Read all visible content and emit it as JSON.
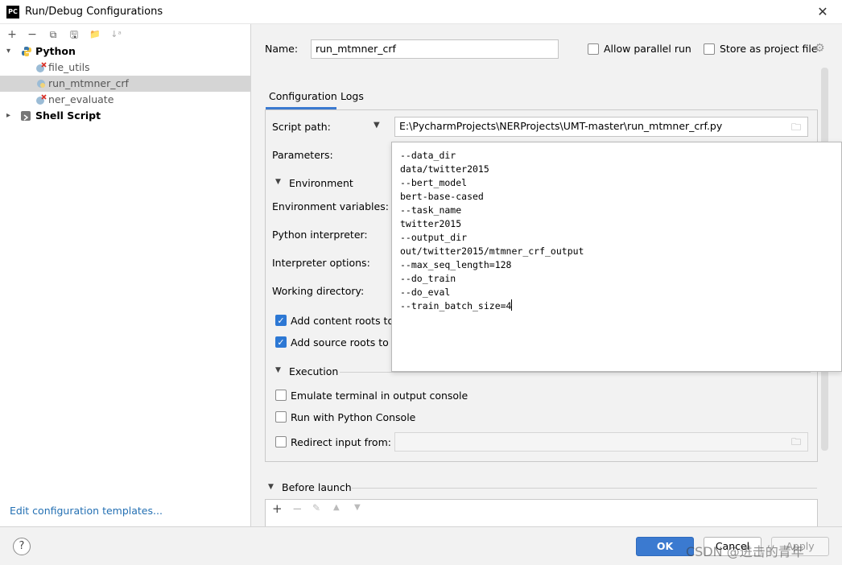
{
  "window": {
    "title": "Run/Debug Configurations",
    "logo_text": "PC",
    "close_glyph": "✕"
  },
  "left_toolbar": {
    "add": "+",
    "remove": "−",
    "copy": "⧉",
    "save": "🖫",
    "folder": "📁",
    "sort": "↓ᵃ"
  },
  "tree": {
    "python_label": "Python",
    "python_children": [
      {
        "label": "file_utils",
        "state": "error"
      },
      {
        "label": "run_mtmner_crf",
        "state": "selected"
      },
      {
        "label": "ner_evaluate",
        "state": "error"
      }
    ],
    "shell_label": "Shell Script"
  },
  "edit_templates_link": "Edit configuration templates...",
  "form": {
    "name_label": "Name:",
    "name_value": "run_mtmner_crf",
    "allow_parallel": "Allow parallel run",
    "store_project": "Store as project file",
    "tabs": [
      "Configuration",
      "Logs"
    ],
    "script_path_label": "Script path:",
    "script_path_value": "E:\\PycharmProjects\\NERProjects\\UMT-master\\run_mtmner_crf.py",
    "parameters_label": "Parameters:",
    "environment_section": "Environment",
    "env_vars_label": "Environment variables:",
    "interpreter_label": "Python interpreter:",
    "interp_options_label": "Interpreter options:",
    "working_dir_label": "Working directory:",
    "add_content_roots": "Add content roots to",
    "add_source_roots": "Add source roots to P",
    "execution_section": "Execution",
    "emulate_terminal": "Emulate terminal in output console",
    "run_python_console": "Run with Python Console",
    "redirect_input": "Redirect input from:",
    "before_launch": "Before launch"
  },
  "parameters_text": "--data_dir\ndata/twitter2015\n--bert_model\nbert-base-cased\n--task_name\ntwitter2015\n--output_dir\nout/twitter2015/mtmner_crf_output\n--max_seq_length=128\n--do_train\n--do_eval\n--train_batch_size=4",
  "buttons": {
    "help": "?",
    "ok": "OK",
    "cancel": "Cancel",
    "apply": "Apply"
  },
  "watermark": "CSDN @进击的青年",
  "colors": {
    "accent": "#3b7ad0",
    "link": "#2470b3",
    "selection": "#d5d5d5"
  }
}
